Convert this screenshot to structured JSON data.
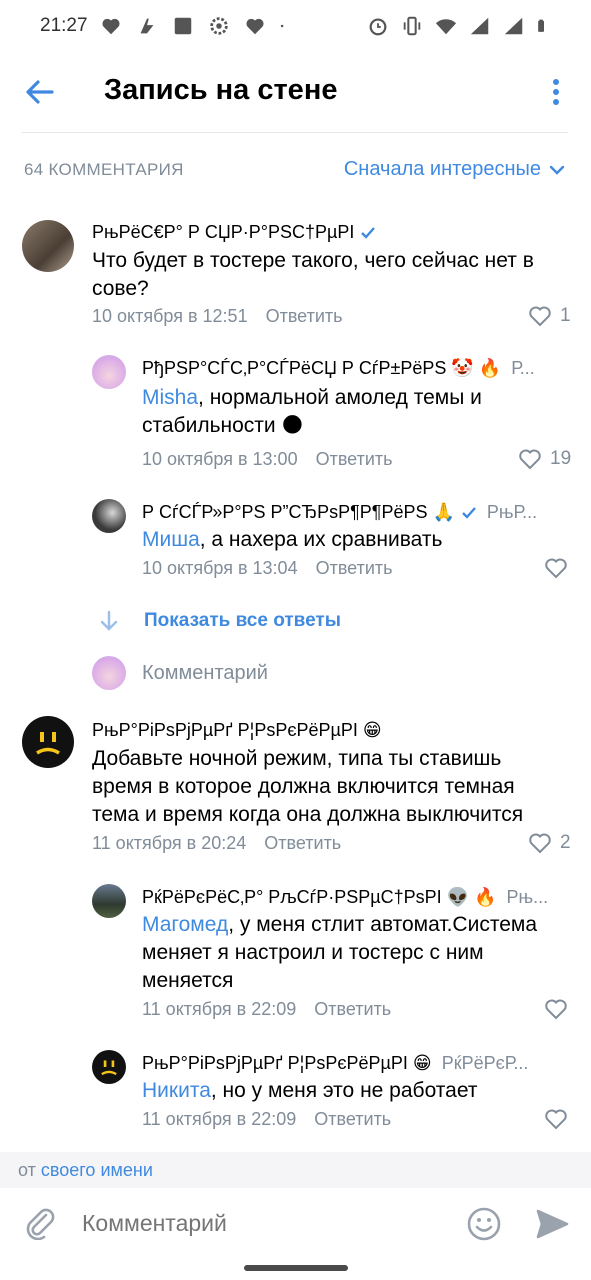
{
  "status_bar": {
    "time": "21:27"
  },
  "header": {
    "title": "Запись на стене"
  },
  "comments_header": {
    "count": "64 КОММЕНТАРИЯ",
    "sort": "Сначала интересные"
  },
  "comments": [
    {
      "name": "РњРёС€Р° Р СЏР·Р°РЅС†РµРІ",
      "text": "Что будет в тостере такого, чего сейчас нет в сове?",
      "date": "10 октября в 12:51",
      "reply": "Ответить",
      "likes": "1"
    },
    {
      "name": "РђРЅР°СЃС‚Р°СЃРёСЏ Р СѓР±РёРЅ 🤡 🔥",
      "extra": "Р...",
      "mention": "Misha",
      "text_after": ", нормальной амолед темы и стабильности 🌑",
      "date": "10 октября в 13:00",
      "reply": "Ответить",
      "likes": "19"
    },
    {
      "name": "Р СѓСЃР»Р°РЅ Р”СЂРѕР¶Р¶РёРЅ 🙏",
      "extra": "РњР...",
      "mention": "Миша",
      "text_after": ", а нахера их сравнивать",
      "date": "10 октября в 13:04",
      "reply": "Ответить",
      "likes": ""
    },
    {
      "name": "РњР°РіРѕРјРµРґ Р¦РѕРєРёРµРІ 😁",
      "text": "Добавьте ночной режим, типа ты ставишь время в которое должна включится темная тема и время когда она должна выключится",
      "date": "11 октября в 20:24",
      "reply": "Ответить",
      "likes": "2"
    },
    {
      "name": "РќРёРєРёС‚Р° РљСѓР·РЅРµС†РѕРІ 👽 🔥",
      "extra": "Рњ...",
      "mention": "Магомед",
      "text_after": ", у меня стлит автомат.Система меняет я настроил и тостерс с ним меняется",
      "date": "11 октября в 22:09",
      "reply": "Ответить",
      "likes": ""
    },
    {
      "name": "РњР°РіРѕРјРµРґ Р¦РѕРєРёРµРІ 😁",
      "extra": "РќРёРєР...",
      "mention": "Никита",
      "text_after": ", но у меня это не работает",
      "date": "11 октября в 22:09",
      "reply": "Ответить",
      "likes": ""
    }
  ],
  "show_all_replies": "Показать все ответы",
  "reply_placeholder": "Комментарий",
  "from_bar": {
    "prefix": "от ",
    "link": "своего имени"
  },
  "composer": {
    "placeholder": "Комментарий"
  },
  "colors": {
    "accent": "#3f8ae0",
    "secondary": "#818c99"
  }
}
